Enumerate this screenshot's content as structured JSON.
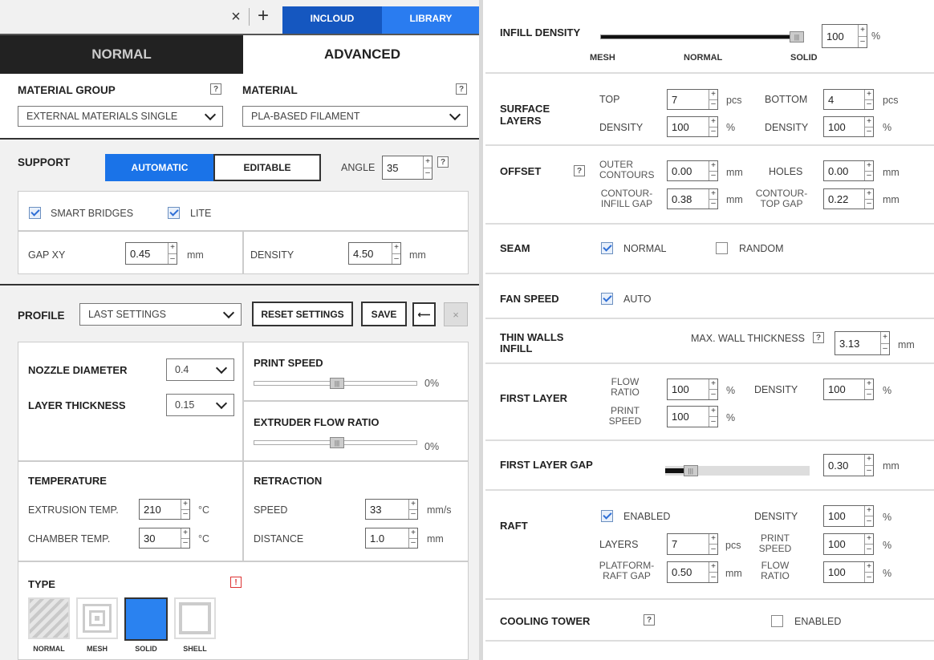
{
  "topbar": {
    "close": "×",
    "add": "+",
    "incloud": "INCLOUD",
    "library": "LIBRARY"
  },
  "modes": {
    "normal": "NORMAL",
    "advanced": "ADVANCED"
  },
  "material": {
    "group_label": "MATERIAL GROUP",
    "group_value": "EXTERNAL MATERIALS SINGLE",
    "material_label": "MATERIAL",
    "material_value": "PLA-BASED FILAMENT",
    "help": "?"
  },
  "support": {
    "label": "SUPPORT",
    "automatic": "AUTOMATIC",
    "editable": "EDITABLE",
    "angle_label": "ANGLE",
    "angle": "35",
    "smart_bridges": "SMART BRIDGES",
    "lite": "LITE",
    "gap_label": "GAP XY",
    "gap": "0.45",
    "gap_unit": "mm",
    "density_label": "DENSITY",
    "density": "4.50",
    "density_unit": "mm"
  },
  "profile": {
    "label": "PROFILE",
    "value": "LAST SETTINGS",
    "reset": "RESET SETTINGS",
    "save": "SAVE",
    "back": "⟵",
    "close": "×"
  },
  "settings": {
    "nozzle_label": "NOZZLE DIAMETER",
    "nozzle": "0.4",
    "layer_label": "LAYER THICKNESS",
    "layer": "0.15",
    "print_speed_label": "PRINT SPEED",
    "print_speed": "0%",
    "flow_label": "EXTRUDER FLOW RATIO",
    "flow": "0%",
    "temp_label": "TEMPERATURE",
    "ext_temp_label": "EXTRUSION TEMP.",
    "ext_temp": "210",
    "chamber_label": "CHAMBER TEMP.",
    "chamber": "30",
    "temp_unit": "°C",
    "retraction_label": "RETRACTION",
    "speed_label": "SPEED",
    "speed": "33",
    "speed_unit": "mm/s",
    "distance_label": "DISTANCE",
    "distance": "1.0",
    "distance_unit": "mm"
  },
  "type": {
    "label": "TYPE",
    "warn": "!",
    "normal": "NORMAL",
    "mesh": "MESH",
    "solid": "SOLID",
    "shell": "SHELL"
  },
  "infill": {
    "label": "INFILL DENSITY",
    "value": "100",
    "unit": "%",
    "mesh": "MESH",
    "normal": "NORMAL",
    "solid": "SOLID",
    "level": 1.0
  },
  "surface": {
    "label1": "SURFACE",
    "label2": "LAYERS",
    "top_label": "TOP",
    "top": "7",
    "top_unit": "pcs",
    "bottom_label": "BOTTOM",
    "bottom": "4",
    "bottom_unit": "pcs",
    "density_label": "DENSITY",
    "density_top": "100",
    "density_bottom": "100",
    "pct": "%"
  },
  "offset": {
    "label": "OFFSET",
    "help": "?",
    "outer1": "OUTER",
    "outer2": "CONTOURS",
    "outer": "0.00",
    "holes_label": "HOLES",
    "holes": "0.00",
    "cig1": "CONTOUR-",
    "cig2": "INFILL GAP",
    "cig": "0.38",
    "ctg1": "CONTOUR-",
    "ctg2": "TOP GAP",
    "ctg": "0.22",
    "mm": "mm"
  },
  "seam": {
    "label": "SEAM",
    "normal": "NORMAL",
    "random": "RANDOM"
  },
  "fan": {
    "label": "FAN SPEED",
    "auto": "AUTO"
  },
  "thin": {
    "label1": "THIN WALLS",
    "label2": "INFILL",
    "max_label": "MAX. WALL THICKNESS",
    "help": "?",
    "value": "3.13",
    "unit": "mm"
  },
  "first": {
    "label": "FIRST LAYER",
    "flow1": "FLOW",
    "flow2": "RATIO",
    "flow": "100",
    "speed1": "PRINT",
    "speed2": "SPEED",
    "speed": "100",
    "density_label": "DENSITY",
    "density": "100",
    "pct": "%"
  },
  "gap": {
    "label": "FIRST LAYER GAP",
    "value": "0.30",
    "unit": "mm",
    "level": 0.16
  },
  "raft": {
    "label": "RAFT",
    "enabled": "ENABLED",
    "density_label": "DENSITY",
    "density": "100",
    "layers_label": "LAYERS",
    "layers": "7",
    "layers_unit": "pcs",
    "ps1": "PRINT",
    "ps2": "SPEED",
    "ps": "100",
    "prg1": "PLATFORM-",
    "prg2": "RAFT GAP",
    "prg": "0.50",
    "prg_unit": "mm",
    "fr1": "FLOW",
    "fr2": "RATIO",
    "fr": "100",
    "pct": "%"
  },
  "cooling": {
    "label": "COOLING TOWER",
    "help": "?",
    "enabled": "ENABLED"
  },
  "colors": {
    "accent": "#1a73e8",
    "dark": "#222222"
  }
}
